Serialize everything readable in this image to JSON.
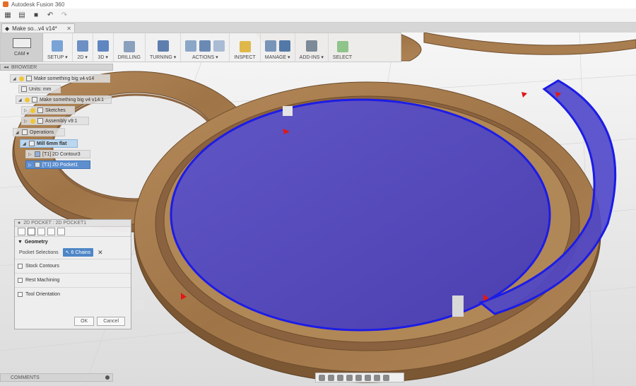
{
  "titlebar": {
    "title": "Autodesk Fusion 360"
  },
  "doc_tab": {
    "label": "Make so...v4 v14*"
  },
  "toolbar": {
    "workspace_label": "CAM ▾",
    "groups": [
      {
        "label": "SETUP ▾"
      },
      {
        "label": "2D ▾"
      },
      {
        "label": "3D ▾"
      },
      {
        "label": "DRILLING"
      },
      {
        "label": "TURNING ▾"
      },
      {
        "label": "ACTIONS ▾"
      },
      {
        "label": "INSPECT"
      },
      {
        "label": "MANAGE ▾"
      },
      {
        "label": "ADD-INS ▾"
      },
      {
        "label": "SELECT"
      }
    ]
  },
  "browser": {
    "header": "BROWSER",
    "nodes": [
      {
        "label": "Make something big v4 v14"
      },
      {
        "label": "Units: mm"
      },
      {
        "label": "Make something big v4 v14:1"
      },
      {
        "label": "Sketches"
      },
      {
        "label": "Assembly v9:1"
      },
      {
        "label": "Operations"
      },
      {
        "label": "Mill 6mm flat"
      },
      {
        "label": "[T1] 2D Contour3"
      },
      {
        "label": "[T1] 2D Pocket1"
      }
    ]
  },
  "panel": {
    "title": "2D POCKET : 2D POCKET1",
    "section_geometry": "Geometry",
    "pocket_selections_label": "Pocket Selections",
    "chains_value": "6 Chains",
    "stock_contours": "Stock Contours",
    "rest_machining": "Rest Machining",
    "tool_orientation": "Tool Orientation",
    "ok": "OK",
    "cancel": "Cancel"
  },
  "comments": {
    "label": "COMMENTS"
  },
  "colors": {
    "wood": "#a67c4f",
    "wood_dark": "#7f5a36",
    "selection_fill": "#4b45c7",
    "selection_edge": "#1c1ce6",
    "background": "#e9e9e9"
  }
}
